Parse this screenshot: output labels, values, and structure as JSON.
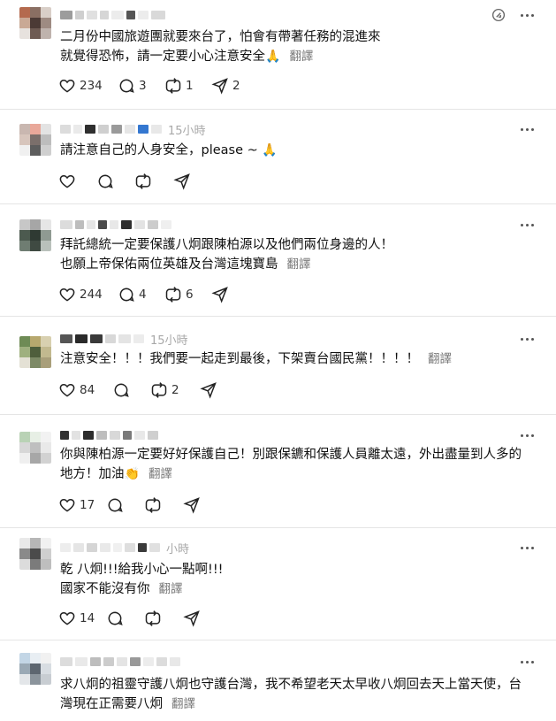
{
  "translate_label": "翻譯",
  "posts": [
    {
      "timestamp": "",
      "lines": [
        "二月份中國旅遊團就要來台了，怕會有帶著任務的混進來",
        "就覺得恐怖，請一定要小心注意安全"
      ],
      "emoji": "🙏",
      "has_translate": true,
      "likes": "234",
      "replies": "3",
      "reposts": "1",
      "shares": "2"
    },
    {
      "timestamp": "15小時",
      "lines": [
        "請注意自己的人身安全，please ~"
      ],
      "emoji": "🙏",
      "has_translate": false,
      "likes": "",
      "replies": "",
      "reposts": "",
      "shares": ""
    },
    {
      "timestamp": "",
      "lines": [
        "拜託總統一定要保護八炯跟陳柏源以及他們兩位身邊的人！",
        "也願上帝保佑兩位英雄及台灣這塊寶島"
      ],
      "emoji": "",
      "has_translate": true,
      "likes": "244",
      "replies": "4",
      "reposts": "6",
      "shares": ""
    },
    {
      "timestamp": "15小時",
      "lines": [
        "注意安全！！！我們要一起走到最後，下架賣台國民黨！！！！"
      ],
      "emoji": "",
      "has_translate": true,
      "likes": "84",
      "replies": "",
      "reposts": "2",
      "shares": ""
    },
    {
      "timestamp": "",
      "lines": [
        "你與陳柏源一定要好好保護自己！別跟保鑣和保護人員離太遠，外出盡量到人多的",
        "地方！加油"
      ],
      "emoji": "👏",
      "has_translate": true,
      "likes": "17",
      "replies": "",
      "reposts": "",
      "shares": ""
    },
    {
      "timestamp": "小時",
      "lines": [
        "乾 八炯!!!給我小心一點啊!!!",
        "國家不能沒有你"
      ],
      "emoji": "",
      "has_translate": true,
      "likes": "14",
      "replies": "",
      "reposts": "",
      "shares": ""
    },
    {
      "timestamp": "",
      "lines": [
        "求八炯的祖靈守護八炯也守護台灣，我不希望老天太早收八炯回去天上當天使，台",
        "灣現在正需要八炯"
      ],
      "emoji": "",
      "has_translate": true,
      "likes": "",
      "replies": "",
      "reposts": "",
      "shares": ""
    }
  ]
}
